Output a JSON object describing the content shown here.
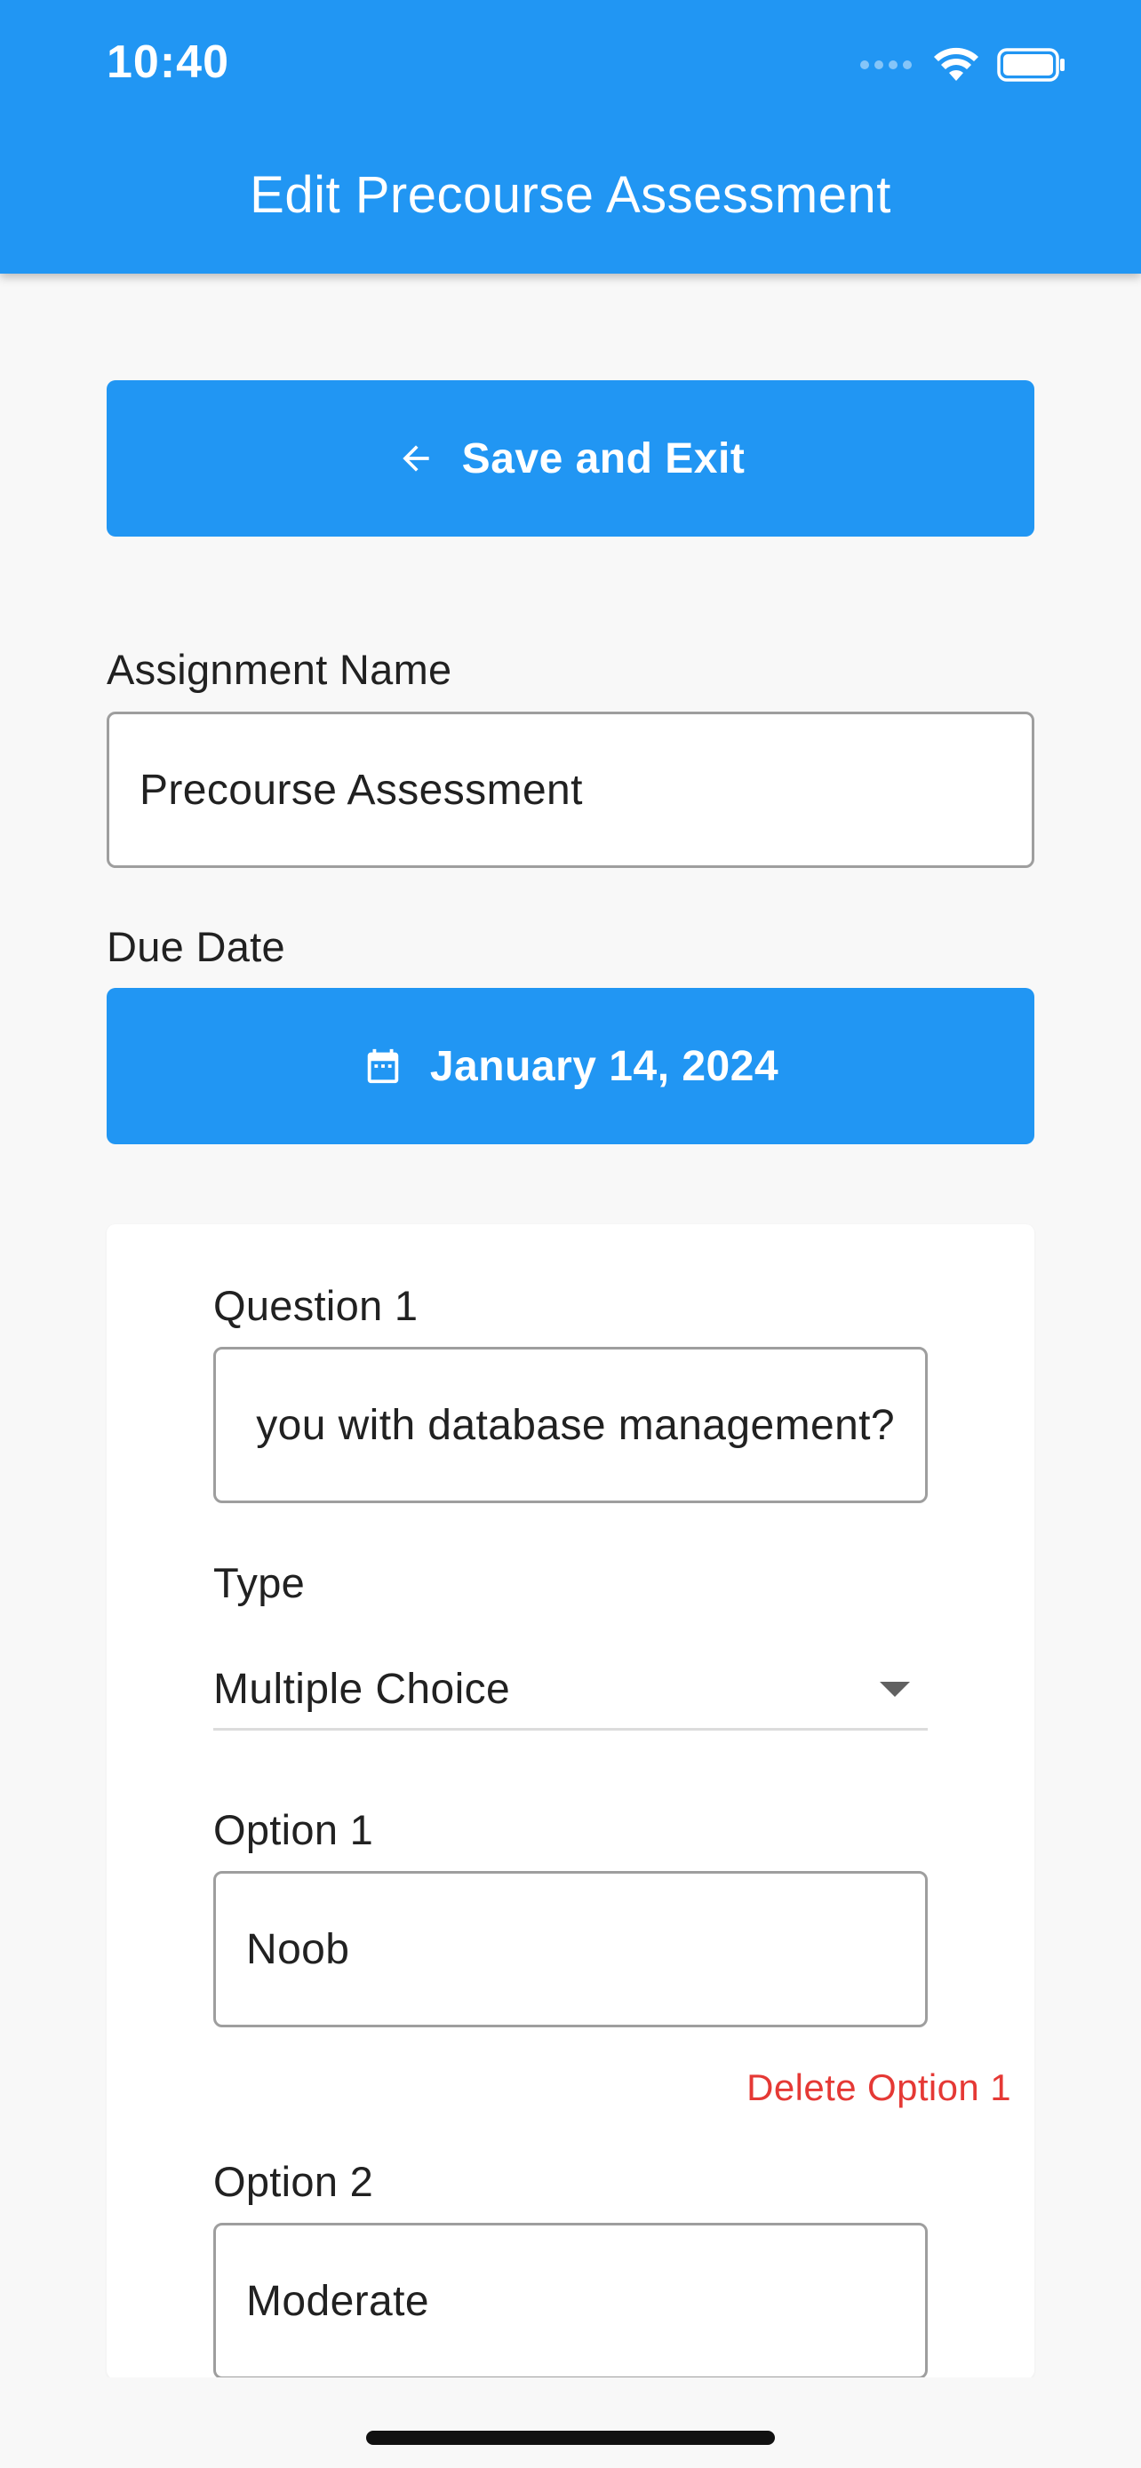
{
  "status_bar": {
    "time": "10:40"
  },
  "app_bar": {
    "title": "Edit Precourse Assessment"
  },
  "save_button": {
    "label": "Save and Exit",
    "icon": "arrow-back-icon"
  },
  "assignment": {
    "label": "Assignment Name",
    "value": "Precourse Assessment"
  },
  "due_date": {
    "label": "Due Date",
    "value": "January 14, 2024",
    "icon": "calendar-icon"
  },
  "question": {
    "label": "Question 1",
    "value": "you with database management?",
    "type_label": "Type",
    "type_value": "Multiple Choice",
    "options": [
      {
        "label": "Option 1",
        "value": "Noob",
        "delete_label": "Delete Option 1"
      },
      {
        "label": "Option 2",
        "value": "Moderate"
      }
    ]
  },
  "colors": {
    "primary": "#2196f3",
    "danger": "#e53935",
    "background": "#f8f8f8"
  }
}
